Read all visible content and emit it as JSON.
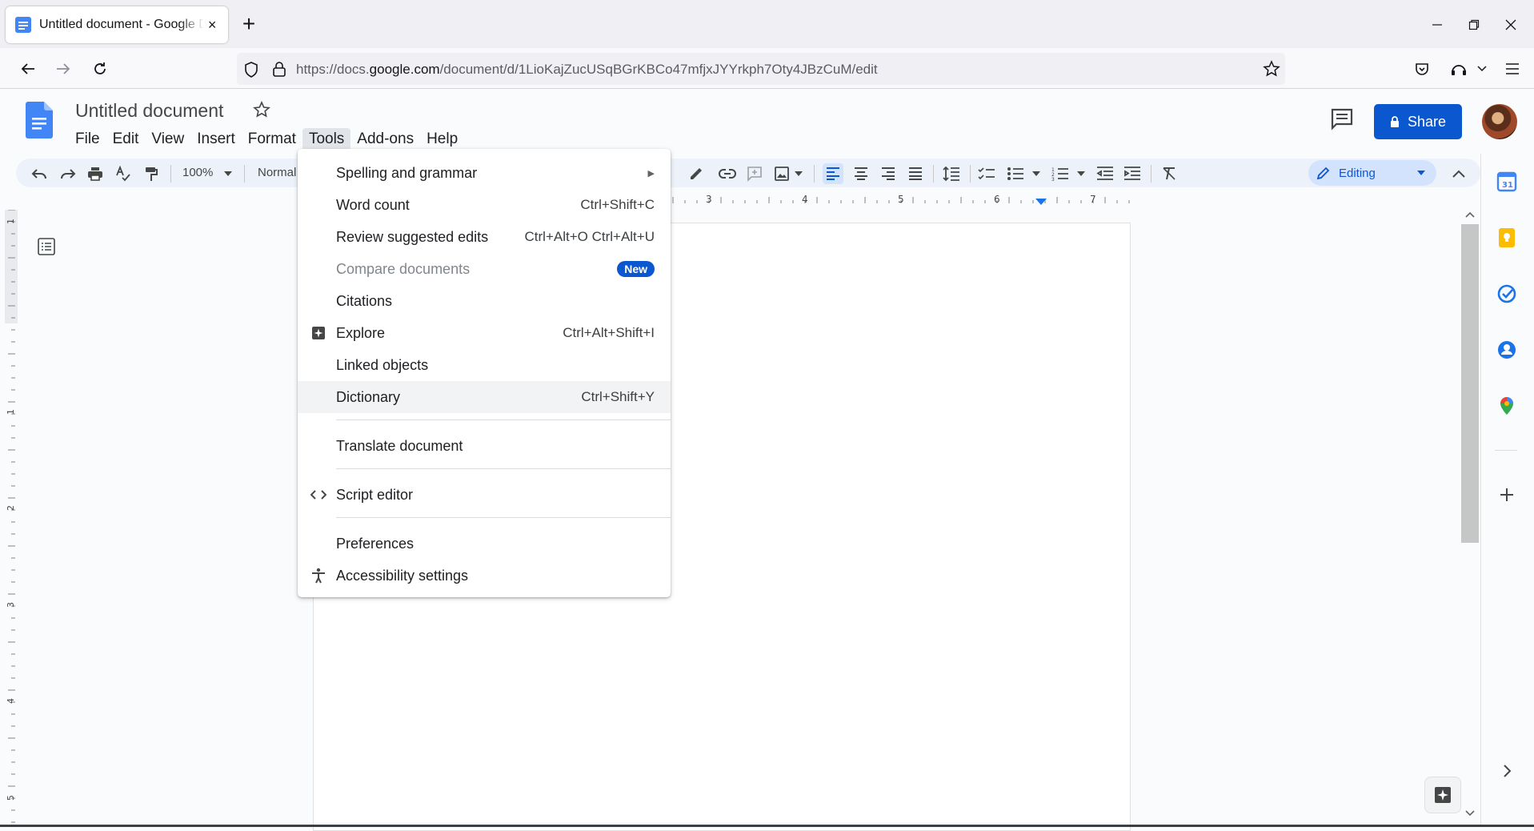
{
  "browser": {
    "tab_title": "Untitled document - Google Docs",
    "tab_close": "×",
    "new_tab": "+",
    "url_prefix": "https://docs.",
    "url_host": "google.com",
    "url_path": "/document/d/1LioKajZucUSqBGrKBCo47mfjxJYYrkph7Oty4JBzCuM/edit"
  },
  "docs": {
    "title": "Untitled document",
    "menus": [
      "File",
      "Edit",
      "View",
      "Insert",
      "Format",
      "Tools",
      "Add-ons",
      "Help"
    ],
    "active_menu": "Tools",
    "share_label": "Share",
    "zoom": "100%",
    "style": "Normal",
    "mode": "Editing"
  },
  "ruler": {
    "h_labels": [
      "3",
      "4",
      "5",
      "6",
      "7"
    ],
    "v_labels": [
      "1",
      "1",
      "2",
      "3",
      "4",
      "5"
    ]
  },
  "tools_menu": {
    "items": [
      {
        "label": "Spelling and grammar",
        "shortcut": "",
        "submenu": true
      },
      {
        "label": "Word count",
        "shortcut": "Ctrl+Shift+C"
      },
      {
        "label": "Review suggested edits",
        "shortcut": "Ctrl+Alt+O Ctrl+Alt+U"
      },
      {
        "label": "Compare documents",
        "shortcut": "",
        "badge": "New",
        "disabled": true
      },
      {
        "label": "Citations",
        "shortcut": ""
      },
      {
        "label": "Explore",
        "shortcut": "Ctrl+Alt+Shift+I",
        "icon": "explore-icon"
      },
      {
        "label": "Linked objects",
        "shortcut": ""
      },
      {
        "label": "Dictionary",
        "shortcut": "Ctrl+Shift+Y",
        "hovered": true
      },
      {
        "label": "Translate document",
        "shortcut": ""
      },
      {
        "label": "Script editor",
        "shortcut": "",
        "icon": "code-icon"
      },
      {
        "label": "Preferences",
        "shortcut": ""
      },
      {
        "label": "Accessibility settings",
        "shortcut": "",
        "icon": "accessibility-icon"
      }
    ]
  },
  "colors": {
    "accent": "#0b57d0",
    "toolbar_bg": "#edf2fa",
    "editing_bg": "#d3e3fd"
  }
}
